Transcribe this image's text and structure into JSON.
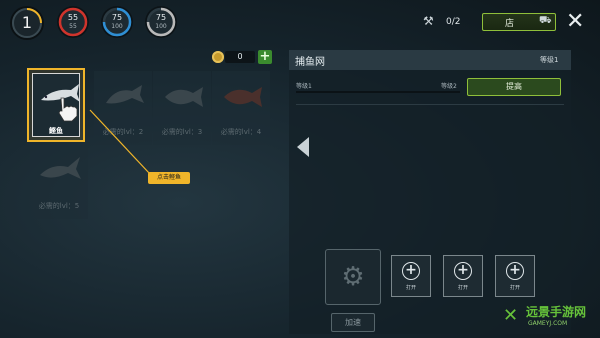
{
  "player": {
    "level": "1"
  },
  "stats": [
    {
      "value": "55",
      "max": "55",
      "color": "#d0342c"
    },
    {
      "value": "75",
      "max": "100",
      "color": "#2f8fd4"
    },
    {
      "value": "75",
      "max": "100",
      "color": "#b9b9b9"
    }
  ],
  "header": {
    "tool_count": "0/2",
    "shop_label": "店"
  },
  "currency": {
    "amount": "0"
  },
  "fish_list": [
    {
      "label": "鲣鱼",
      "selected": true
    },
    {
      "label": "必需的lvl：2",
      "selected": false
    },
    {
      "label": "必需的lvl：3",
      "selected": false
    },
    {
      "label": "必需的lvl：4",
      "selected": false
    },
    {
      "label": "必需的lvl：5",
      "selected": false
    }
  ],
  "tooltip": "点击鲣鱼",
  "panel": {
    "title": "捕鱼网",
    "level_label": "等级1",
    "current_level": "等级1",
    "next_level": "等级2",
    "upgrade_label": "提高",
    "speed_label": "加速",
    "open_label": "打开"
  },
  "watermark": {
    "title": "远景手游网",
    "url": "GAMEYJ.COM"
  },
  "colors": {
    "accent_gold": "#f0b52a",
    "accent_green": "#8fbf3a"
  }
}
